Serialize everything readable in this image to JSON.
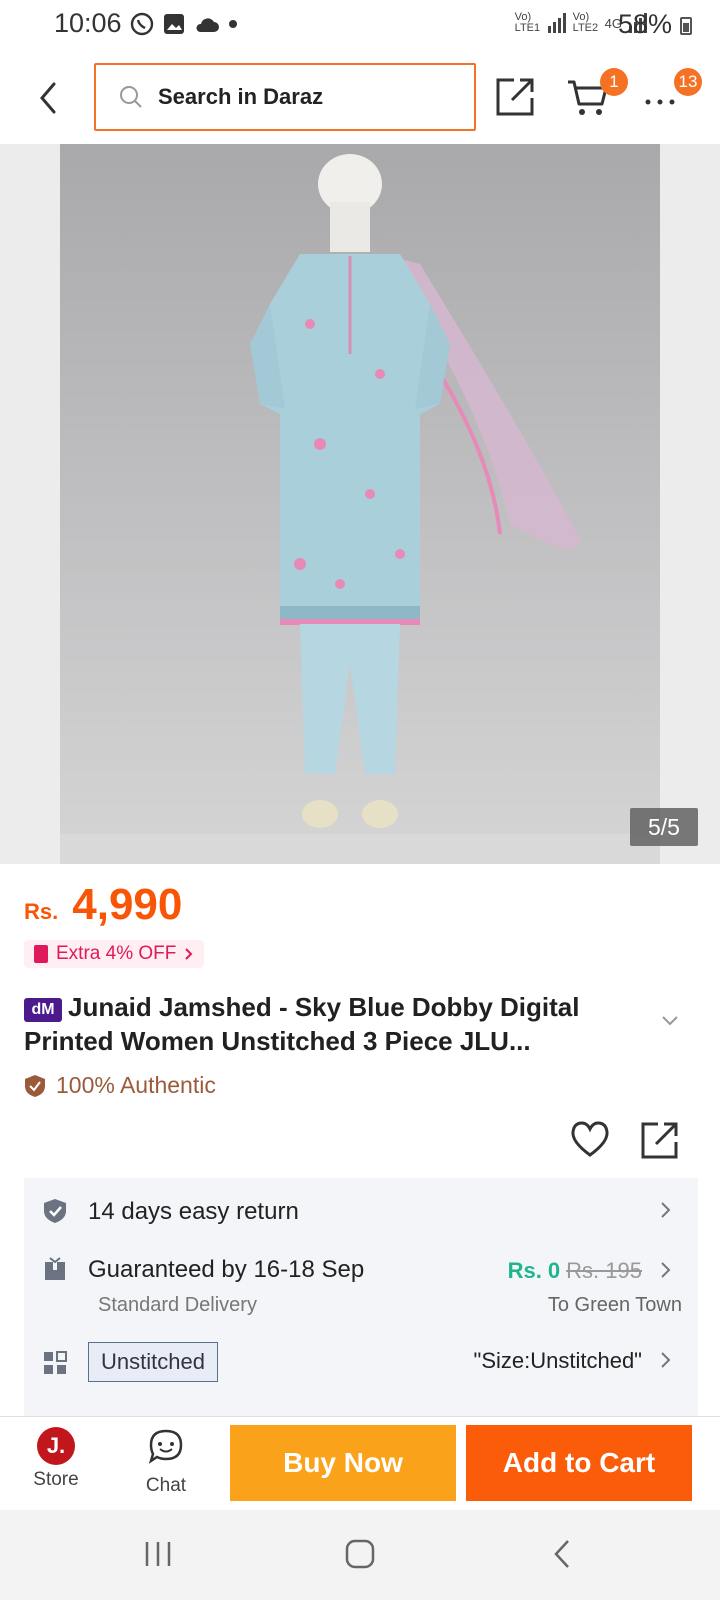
{
  "status": {
    "time": "10:06",
    "battery": "58%",
    "net1": "Vo) LTE1",
    "net2": "Vo) LTE2",
    "net3": "4G"
  },
  "header": {
    "search_placeholder": "Search in Daraz",
    "cart_count": "1",
    "more_count": "13"
  },
  "gallery": {
    "counter": "5/5"
  },
  "product": {
    "currency": "Rs.",
    "price": "4,990",
    "promo": "Extra 4% OFF",
    "brand_badge": "dM",
    "title": "Junaid Jamshed - Sky Blue Dobby Digital Printed Women Unstitched 3 Piece JLU...",
    "authentic": "100% Authentic"
  },
  "info": {
    "return": "14 days easy return",
    "delivery": "Guaranteed by 16-18 Sep",
    "delivery_type": "Standard Delivery",
    "fee": "Rs. 0",
    "fee_old": "Rs. 195",
    "destination": "To Green Town",
    "variant_chip": "Unstitched",
    "variant_value": "\"Size:Unstitched\""
  },
  "bottom": {
    "store": "Store",
    "store_logo": "J.",
    "chat": "Chat",
    "buy_now": "Buy Now",
    "add_to_cart": "Add to Cart"
  },
  "colors": {
    "accent": "#f57224",
    "buy": "#faa31a",
    "cart": "#fa5c0a",
    "free_shipping": "#1fb58f",
    "promo": "#e0195d"
  }
}
